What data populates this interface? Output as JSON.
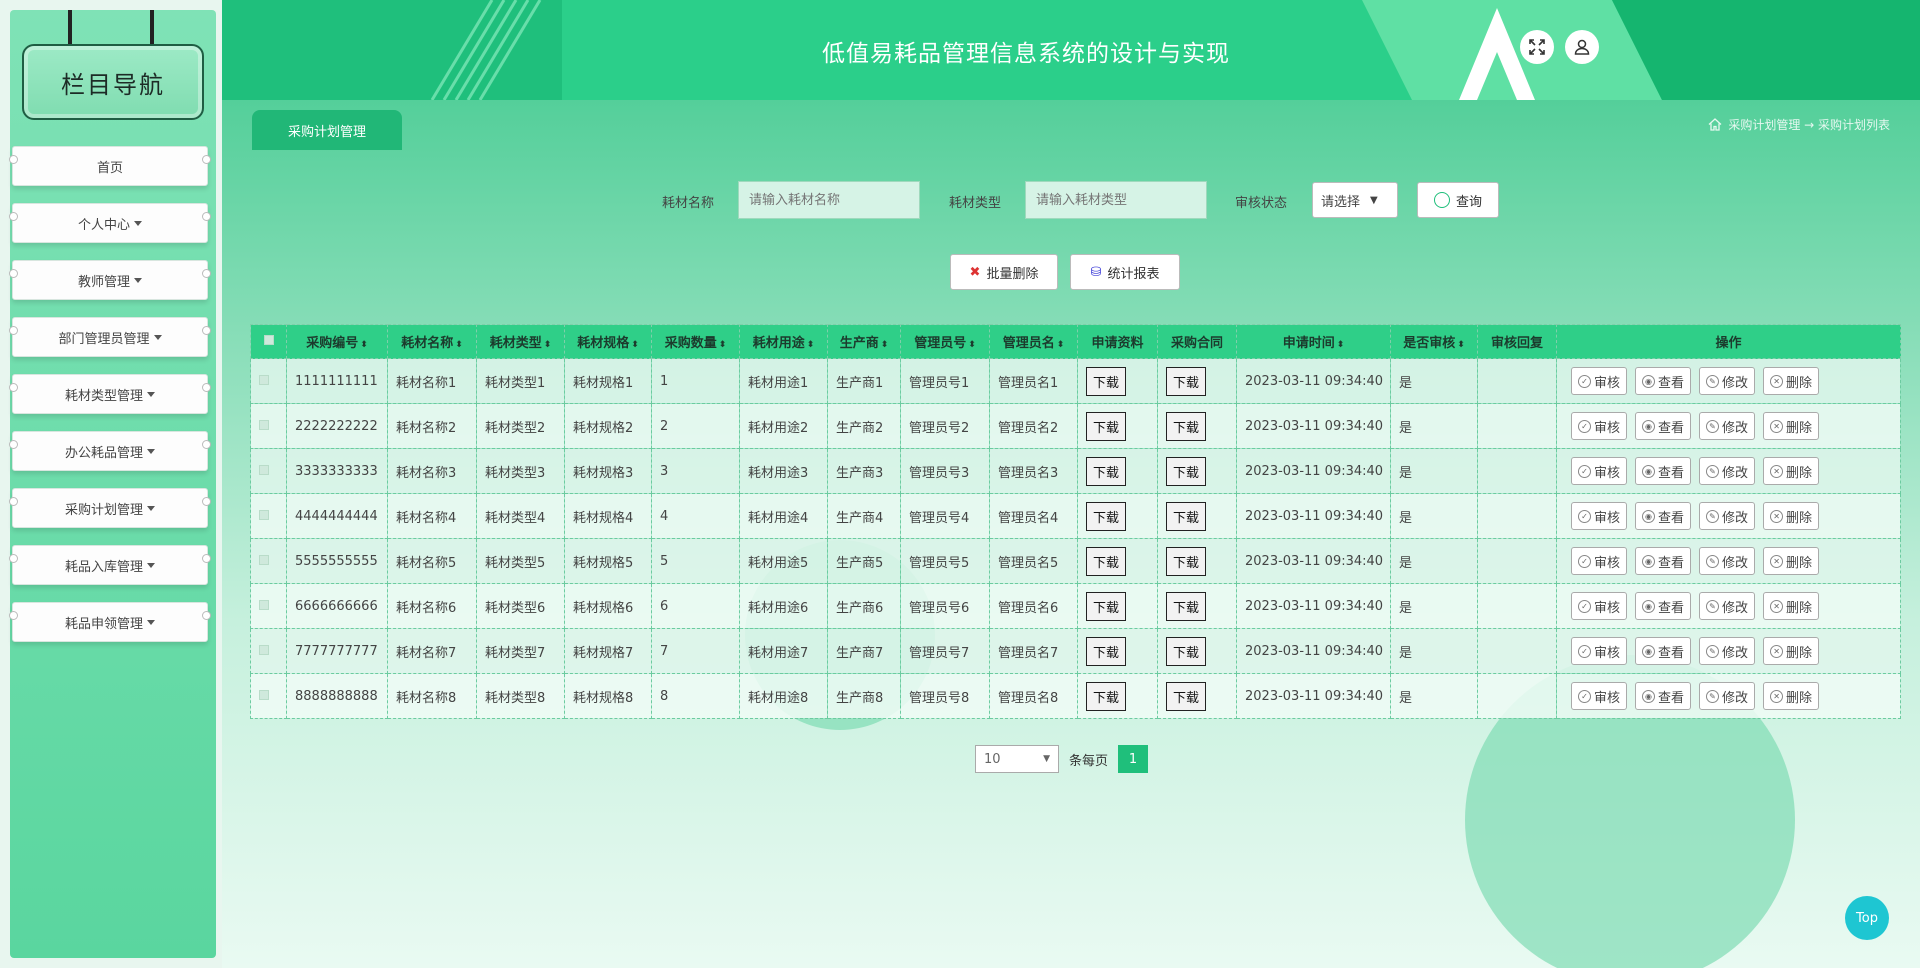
{
  "sidebar": {
    "title": "栏目导航",
    "items": [
      {
        "label": "首页",
        "dropdown": false
      },
      {
        "label": "个人中心",
        "dropdown": true
      },
      {
        "label": "教师管理",
        "dropdown": true
      },
      {
        "label": "部门管理员管理",
        "dropdown": true
      },
      {
        "label": "耗材类型管理",
        "dropdown": true
      },
      {
        "label": "办公耗品管理",
        "dropdown": true
      },
      {
        "label": "采购计划管理",
        "dropdown": true
      },
      {
        "label": "耗品入库管理",
        "dropdown": true
      },
      {
        "label": "耗品申领管理",
        "dropdown": true
      }
    ]
  },
  "header": {
    "title": "低值易耗品管理信息系统的设计与实现",
    "fullscreen_icon": "expand-icon",
    "user_icon": "user-icon"
  },
  "tab": {
    "label": "采购计划管理"
  },
  "breadcrumb": {
    "home_icon": "home-icon",
    "text": "采购计划管理 → 采购计划列表"
  },
  "search": {
    "name_label": "耗材名称",
    "name_placeholder": "请输入耗材名称",
    "type_label": "耗材类型",
    "type_placeholder": "请输入耗材类型",
    "status_label": "审核状态",
    "status_value": "请选择",
    "query_button": "查询"
  },
  "actions": {
    "batch_delete": "批量删除",
    "report": "统计报表"
  },
  "table": {
    "headers": [
      "采购编号",
      "耗材名称",
      "耗材类型",
      "耗材规格",
      "采购数量",
      "耗材用途",
      "生产商",
      "管理员号",
      "管理员名",
      "申请资料",
      "采购合同",
      "申请时间",
      "是否审核",
      "审核回复",
      "操作"
    ],
    "download_label": "下载",
    "ops": [
      "审核",
      "查看",
      "修改",
      "删除"
    ],
    "rows": [
      {
        "id": "1111111111",
        "name": "耗材名称1",
        "type": "耗材类型1",
        "spec": "耗材规格1",
        "qty": "1",
        "use": "耗材用途1",
        "maker": "生产商1",
        "admin_no": "管理员号1",
        "admin_name": "管理员名1",
        "time": "2023-03-11 09:34:40",
        "audited": "是",
        "reply": ""
      },
      {
        "id": "2222222222",
        "name": "耗材名称2",
        "type": "耗材类型2",
        "spec": "耗材规格2",
        "qty": "2",
        "use": "耗材用途2",
        "maker": "生产商2",
        "admin_no": "管理员号2",
        "admin_name": "管理员名2",
        "time": "2023-03-11 09:34:40",
        "audited": "是",
        "reply": ""
      },
      {
        "id": "3333333333",
        "name": "耗材名称3",
        "type": "耗材类型3",
        "spec": "耗材规格3",
        "qty": "3",
        "use": "耗材用途3",
        "maker": "生产商3",
        "admin_no": "管理员号3",
        "admin_name": "管理员名3",
        "time": "2023-03-11 09:34:40",
        "audited": "是",
        "reply": ""
      },
      {
        "id": "4444444444",
        "name": "耗材名称4",
        "type": "耗材类型4",
        "spec": "耗材规格4",
        "qty": "4",
        "use": "耗材用途4",
        "maker": "生产商4",
        "admin_no": "管理员号4",
        "admin_name": "管理员名4",
        "time": "2023-03-11 09:34:40",
        "audited": "是",
        "reply": ""
      },
      {
        "id": "5555555555",
        "name": "耗材名称5",
        "type": "耗材类型5",
        "spec": "耗材规格5",
        "qty": "5",
        "use": "耗材用途5",
        "maker": "生产商5",
        "admin_no": "管理员号5",
        "admin_name": "管理员名5",
        "time": "2023-03-11 09:34:40",
        "audited": "是",
        "reply": ""
      },
      {
        "id": "6666666666",
        "name": "耗材名称6",
        "type": "耗材类型6",
        "spec": "耗材规格6",
        "qty": "6",
        "use": "耗材用途6",
        "maker": "生产商6",
        "admin_no": "管理员号6",
        "admin_name": "管理员名6",
        "time": "2023-03-11 09:34:40",
        "audited": "是",
        "reply": ""
      },
      {
        "id": "7777777777",
        "name": "耗材名称7",
        "type": "耗材类型7",
        "spec": "耗材规格7",
        "qty": "7",
        "use": "耗材用途7",
        "maker": "生产商7",
        "admin_no": "管理员号7",
        "admin_name": "管理员名7",
        "time": "2023-03-11 09:34:40",
        "audited": "是",
        "reply": ""
      },
      {
        "id": "8888888888",
        "name": "耗材名称8",
        "type": "耗材类型8",
        "spec": "耗材规格8",
        "qty": "8",
        "use": "耗材用途8",
        "maker": "生产商8",
        "admin_no": "管理员号8",
        "admin_name": "管理员名8",
        "time": "2023-03-11 09:34:40",
        "audited": "是",
        "reply": ""
      }
    ]
  },
  "pagination": {
    "page_size": "10",
    "per_page_label": "条每页",
    "current_page": "1"
  },
  "top_button": "Top",
  "colors": {
    "accent": "#20c07d",
    "tab": "#21b777",
    "top": "#1ec6d2"
  }
}
